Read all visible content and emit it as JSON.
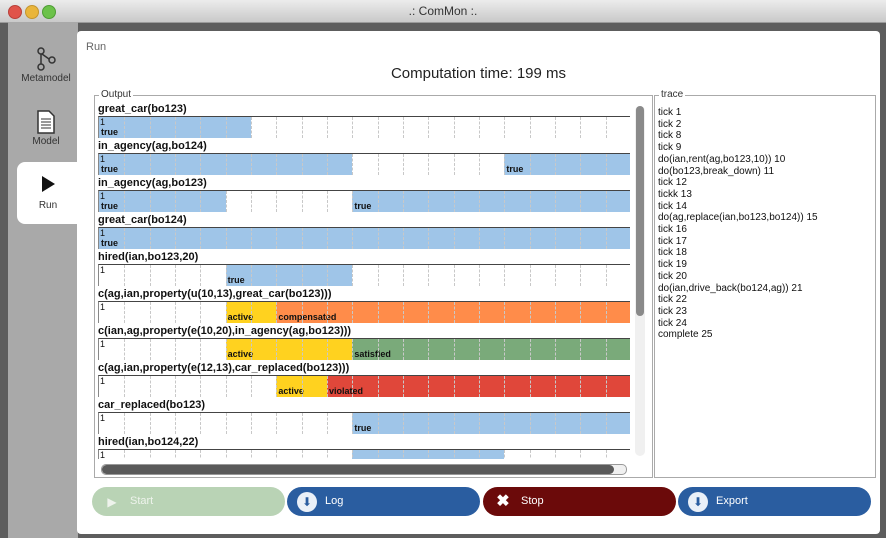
{
  "window": {
    "title": ".: ComMon :."
  },
  "sidebar": {
    "items": [
      {
        "label": "Metamodel",
        "icon": "network-icon"
      },
      {
        "label": "Model",
        "icon": "document-icon"
      },
      {
        "label": "Run",
        "icon": "play-icon"
      }
    ]
  },
  "run": {
    "label": "Run",
    "computation_time": "Computation time: 199 ms",
    "output_label": "Output",
    "trace_label": "trace"
  },
  "colors": {
    "blue": "#9fc5e8",
    "yellow": "#ffd21f",
    "orange": "#ff8c4a",
    "green": "#7aaa7a",
    "red": "#e0473a"
  },
  "output_rows": [
    {
      "title": "great_car(bo123)",
      "one": "1",
      "segments": [
        {
          "from": 0,
          "to": 6,
          "color": "blue",
          "label": "true"
        }
      ]
    },
    {
      "title": "in_agency(ag,bo124)",
      "one": "1",
      "segments": [
        {
          "from": 0,
          "to": 10,
          "color": "blue",
          "label": "true"
        },
        {
          "from": 16,
          "to": 21,
          "color": "blue",
          "label": "true"
        }
      ]
    },
    {
      "title": "in_agency(ag,bo123)",
      "one": "1",
      "segments": [
        {
          "from": 0,
          "to": 5,
          "color": "blue",
          "label": "true"
        },
        {
          "from": 10,
          "to": 21,
          "color": "blue",
          "label": "true"
        }
      ]
    },
    {
      "title": "great_car(bo124)",
      "one": "1",
      "segments": [
        {
          "from": 0,
          "to": 21,
          "color": "blue",
          "label": "true"
        }
      ]
    },
    {
      "title": "hired(ian,bo123,20)",
      "one": "1",
      "segments": [
        {
          "from": 5,
          "to": 10,
          "color": "blue",
          "label": "true"
        }
      ]
    },
    {
      "title": "c(ag,ian,property(u(10,13),great_car(bo123)))",
      "one": "1",
      "segments": [
        {
          "from": 5,
          "to": 7,
          "color": "yellow",
          "label": "active"
        },
        {
          "from": 7,
          "to": 21,
          "color": "orange",
          "label": "compensated"
        }
      ]
    },
    {
      "title": "c(ian,ag,property(e(10,20),in_agency(ag,bo123)))",
      "one": "1",
      "segments": [
        {
          "from": 5,
          "to": 10,
          "color": "yellow",
          "label": "active"
        },
        {
          "from": 10,
          "to": 21,
          "color": "green",
          "label": "satisfied"
        }
      ]
    },
    {
      "title": "c(ag,ian,property(e(12,13),car_replaced(bo123)))",
      "one": "1",
      "segments": [
        {
          "from": 7,
          "to": 9,
          "color": "yellow",
          "label": "active"
        },
        {
          "from": 9,
          "to": 21,
          "color": "red",
          "label": "violated"
        }
      ]
    },
    {
      "title": "car_replaced(bo123)",
      "one": "1",
      "segments": [
        {
          "from": 10,
          "to": 21,
          "color": "blue",
          "label": "true"
        }
      ]
    },
    {
      "title": "hired(ian,bo124,22)",
      "one": "1",
      "segments": [
        {
          "from": 10,
          "to": 16,
          "color": "blue",
          "label": ""
        }
      ]
    }
  ],
  "trace": [
    "tick 1",
    "tick 2",
    "tick 8",
    "tick 9",
    "do(ian,rent(ag,bo123,10)) 10",
    "do(bo123,break_down) 11",
    "tick 12",
    "tickk 13",
    "tick 14",
    "do(ag,replace(ian,bo123,bo124)) 15",
    "tick 16",
    "tick 17",
    "tick 18",
    "tick 19",
    "tick 20",
    "do(ian,drive_back(bo124,ag)) 21",
    "tick 22",
    "tick 23",
    "tick 24",
    "complete 25"
  ],
  "buttons": {
    "start": "Start",
    "log": "Log",
    "stop": "Stop",
    "export": "Export"
  }
}
